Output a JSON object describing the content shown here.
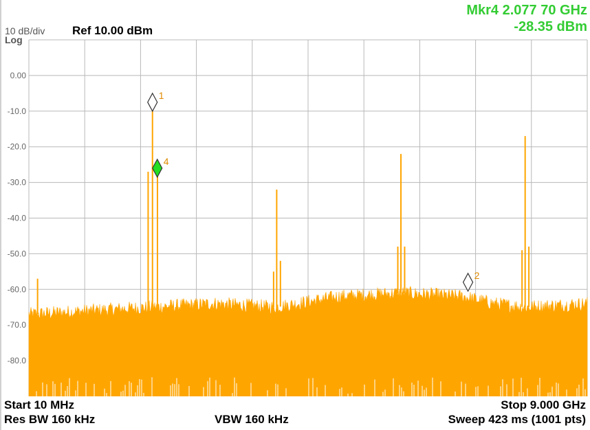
{
  "header": {
    "scale": "10 dB/div",
    "log": "Log",
    "ref": "Ref 10.00 dBm",
    "marker_line1": "Mkr4 2.077 70 GHz",
    "marker_line2": "-28.35 dBm"
  },
  "footer": {
    "start": "Start 10 MHz",
    "stop": "Stop 9.000 GHz",
    "res_bw": "Res BW 160 kHz",
    "vbw": "VBW 160 kHz",
    "sweep": "Sweep  423 ms (1001 pts)"
  },
  "colors": {
    "trace": "#ffa500",
    "grid": "#b8b8b8",
    "active_marker": "#22dd22",
    "marker_outline": "#333333"
  },
  "chart_data": {
    "type": "line",
    "xlabel": "",
    "ylabel": "",
    "xlim": [
      0.01,
      9.0
    ],
    "ylim": [
      -90,
      10
    ],
    "x_unit": "GHz",
    "y_unit": "dBm",
    "grid": true,
    "ytick_labels": [
      "0.00",
      "-10.0",
      "-20.0",
      "-30.0",
      "-40.0",
      "-50.0",
      "-60.0",
      "-70.0",
      "-80.0"
    ],
    "ytick_values": [
      0,
      -10,
      -20,
      -30,
      -40,
      -50,
      -60,
      -70,
      -80
    ],
    "noise_floor": {
      "x": [
        0.01,
        1.0,
        2.0,
        3.0,
        4.0,
        5.0,
        6.0,
        7.0,
        7.5,
        8.0,
        9.0
      ],
      "y": [
        -67,
        -66,
        -65,
        -64,
        -65,
        -62,
        -61,
        -62,
        -64,
        -65,
        -64
      ]
    },
    "spurs": [
      {
        "x": 0.15,
        "y": -57
      },
      {
        "x": 1.93,
        "y": -27
      },
      {
        "x": 2.0,
        "y": -10
      },
      {
        "x": 2.08,
        "y": -28.35
      },
      {
        "x": 3.95,
        "y": -55
      },
      {
        "x": 4.0,
        "y": -32
      },
      {
        "x": 4.06,
        "y": -52
      },
      {
        "x": 5.95,
        "y": -48
      },
      {
        "x": 6.0,
        "y": -22
      },
      {
        "x": 6.06,
        "y": -48
      },
      {
        "x": 7.95,
        "y": -49
      },
      {
        "x": 8.0,
        "y": -17
      },
      {
        "x": 8.06,
        "y": -48
      }
    ],
    "markers": [
      {
        "label": "1",
        "x": 2.0,
        "y": -7.5,
        "active": false
      },
      {
        "label": "4",
        "x": 2.077,
        "y": -26,
        "active": true
      },
      {
        "label": "2",
        "x": 7.08,
        "y": -58,
        "active": false
      }
    ]
  }
}
